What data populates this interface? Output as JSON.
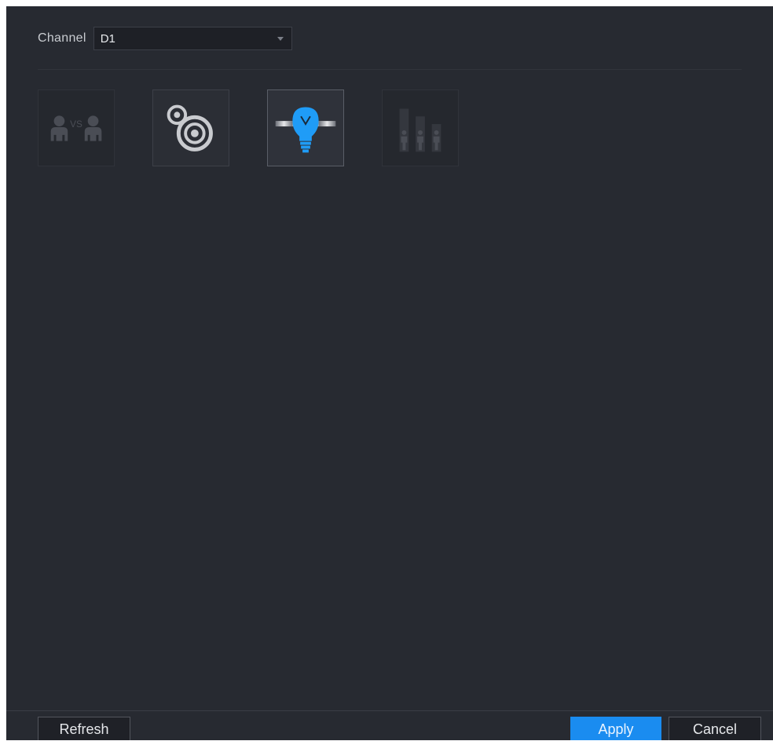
{
  "channel": {
    "label": "Channel",
    "value": "D1"
  },
  "tiles": [
    {
      "name": "people-vs-icon",
      "text": "VS",
      "state": "disabled"
    },
    {
      "name": "camera-lens-icon",
      "state": "normal"
    },
    {
      "name": "tripwire-bulb-icon",
      "state": "active"
    },
    {
      "name": "people-counting-icon",
      "state": "disabled"
    }
  ],
  "buttons": {
    "refresh": "Refresh",
    "apply": "Apply",
    "cancel": "Cancel"
  },
  "colors": {
    "accent": "#1a8cf0",
    "panel": "#272a31",
    "active_icon": "#1f9cf7"
  }
}
